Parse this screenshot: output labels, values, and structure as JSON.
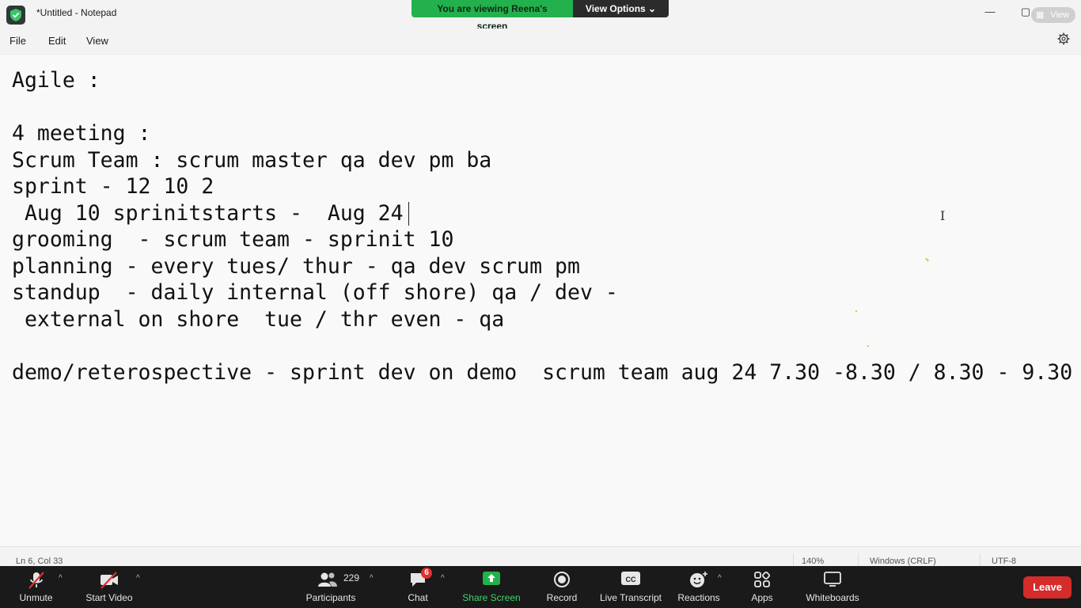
{
  "window": {
    "title": "*Untitled - Notepad",
    "controls": {
      "minimize": "—",
      "restore": "▢",
      "close": "✕"
    }
  },
  "zoom_banner": {
    "viewing": "You are viewing Reena's screen",
    "view_options": "View Options ⌄",
    "view_pill": "View"
  },
  "menu": {
    "file": "File",
    "edit": "Edit",
    "view": "View"
  },
  "editor": {
    "lines": [
      "Agile :",
      "",
      "4 meeting :",
      "Scrum Team : scrum master qa dev pm ba",
      "sprint - 12 10 2",
      " Aug 10 sprinitstarts -  Aug 24 ",
      "grooming  - scrum team - sprinit 10",
      "planning - every tues/ thur - qa dev scrum pm",
      "standup  - daily internal (off shore) qa / dev -",
      " external on shore  tue / thr even - qa",
      "",
      "demo/reterospective - sprint dev on demo  scrum team aug 24 7.30 -8.30 / 8.30 - 9.30"
    ]
  },
  "status": {
    "position": "Ln 6, Col 33",
    "zoom": "140%",
    "line_ending": "Windows (CRLF)",
    "encoding": "UTF-8"
  },
  "toolbar": {
    "unmute": "Unmute",
    "start_video": "Start Video",
    "participants": "Participants",
    "participant_count": "229",
    "chat": "Chat",
    "chat_badge": "6",
    "share_screen": "Share Screen",
    "record": "Record",
    "live_transcript": "Live Transcript",
    "reactions": "Reactions",
    "apps": "Apps",
    "whiteboards": "Whiteboards",
    "leave": "Leave"
  },
  "colors": {
    "banner_green": "#23b14d",
    "share_green": "#23b14d",
    "leave_red": "#d42b2b",
    "badge_red": "#e02f2f"
  }
}
